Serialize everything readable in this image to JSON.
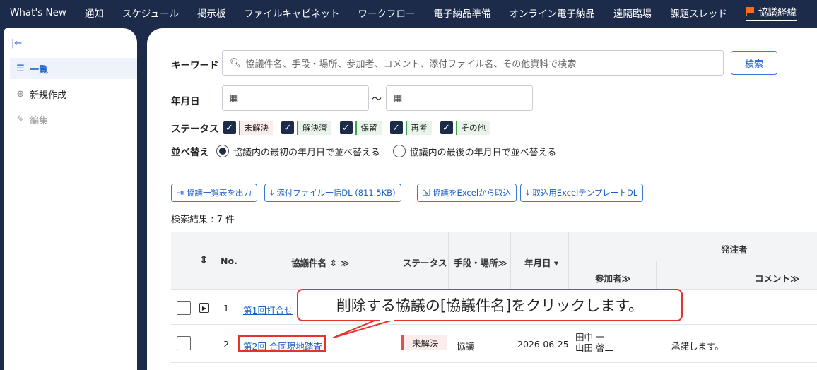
{
  "topnav": {
    "items": [
      "What's New",
      "通知",
      "スケジュール",
      "掲示板",
      "ファイルキャビネット",
      "ワークフロー",
      "電子納品準備",
      "オンライン電子納品",
      "遠隔臨場",
      "課題スレッド"
    ],
    "active": "協議経緯"
  },
  "sidebar": {
    "collapse": "|←",
    "items": [
      {
        "icon": "☰",
        "label": "一覧"
      },
      {
        "icon": "⊕",
        "label": "新規作成"
      },
      {
        "icon": "✎",
        "label": "編集"
      }
    ]
  },
  "search": {
    "keyword_label": "キーワード",
    "keyword_placeholder": "協議件名、手段・場所、参加者、コメント、添付ファイル名、その他資料で検索",
    "search_button": "検索",
    "date_label": "年月日",
    "date_sep": "～",
    "status_label": "ステータス",
    "statuses": [
      "未解決",
      "解決済",
      "保留",
      "再考",
      "その他"
    ],
    "sort_label": "並べ替え",
    "sort_options": [
      "協議内の最初の年月日で並べ替える",
      "協議内の最後の年月日で並べ替える"
    ]
  },
  "actions": {
    "export_list": "協議一覧表を出力",
    "download_attachments": "添付ファイル一括DL (811.5KB)",
    "import_excel": "協議をExcelから取込",
    "template_dl": "取込用ExcelテンプレートDL"
  },
  "result_count": "検索結果 : 7 件",
  "table": {
    "headers": {
      "no": "No.",
      "title": "協議件名 ⇕ ≫",
      "status": "ステータス",
      "method": "手段・場所≫",
      "date": "年月日 ▾",
      "client": "発注者",
      "participants": "参加者≫",
      "comment": "コメント≫"
    },
    "rows": [
      {
        "no": "1",
        "title": "第1回打合せ",
        "status": "",
        "method": "",
        "date": "",
        "participants": "",
        "comment": ""
      },
      {
        "no": "2",
        "title": "第2回 合同現地踏査",
        "status": "未解決",
        "method": "協議",
        "date": "2026-06-25",
        "participants": "田中 一\n山田 啓二",
        "comment": "承諾します。"
      }
    ]
  },
  "callout": "削除する協議の[協議件名]をクリックします。",
  "colors": {
    "nav": "#1c2b4a",
    "accent": "#1b5fc7",
    "callout": "#e5322d"
  }
}
